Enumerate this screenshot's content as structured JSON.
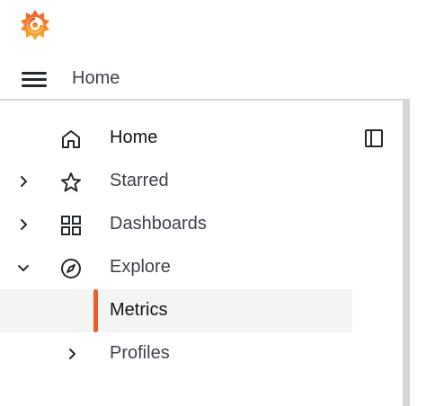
{
  "topbar": {
    "breadcrumb": "Home"
  },
  "nav": {
    "items": [
      {
        "label": "Home"
      },
      {
        "label": "Starred"
      },
      {
        "label": "Dashboards"
      },
      {
        "label": "Explore"
      },
      {
        "label": "Metrics"
      },
      {
        "label": "Profiles"
      }
    ]
  },
  "icons": {
    "logo": "grafana-logo-icon",
    "menu": "hamburger-menu-icon",
    "dock": "dock-menu-icon",
    "home": "home-icon",
    "starred": "star-icon",
    "dashboards": "apps-grid-icon",
    "explore": "compass-icon",
    "chevron_right": "chevron-right-icon",
    "chevron_down": "chevron-down-icon"
  },
  "colors": {
    "accent": "#f05a28",
    "logo_orange": "#f47a20",
    "active_bg": "#f4f4f2"
  }
}
